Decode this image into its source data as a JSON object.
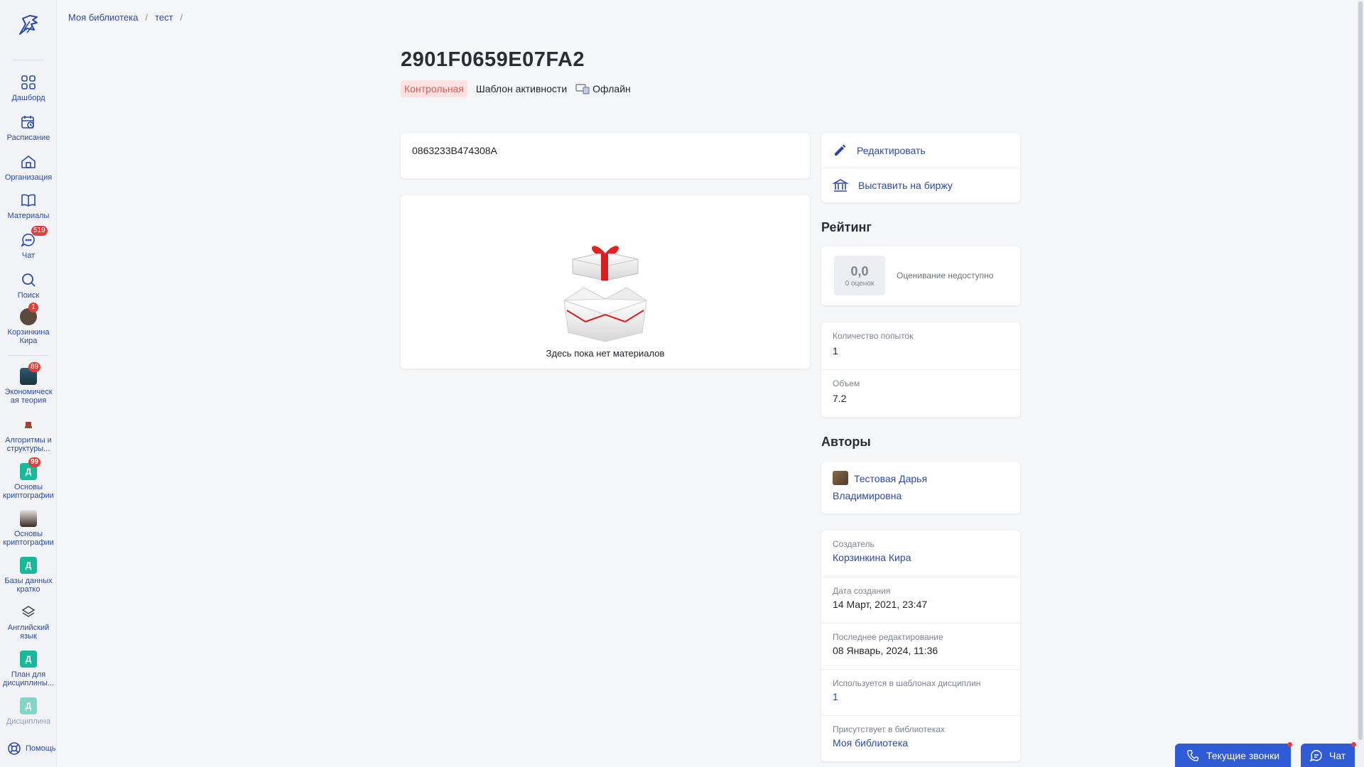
{
  "breadcrumb": {
    "items": [
      "Моя библиотека",
      "тест"
    ],
    "sep": "/"
  },
  "nav": {
    "dashboard": "Дашборд",
    "schedule": "Расписание",
    "organization": "Организация",
    "materials": "Материалы",
    "chat": "Чат",
    "chat_badge": "519",
    "search": "Поиск",
    "user_line1": "Корзинкина",
    "user_line2": "Кира",
    "user_badge": "1",
    "econ_line1": "Экономическ",
    "econ_line2": "ая теория",
    "econ_badge": "89",
    "algo_line1": "Алгоритмы и",
    "algo_line2": "структуры...",
    "crypto1_letter": "Д",
    "crypto1_line1": "Основы",
    "crypto1_line2": "криптографии",
    "crypto1_badge": "99",
    "crypto2_line1": "Основы",
    "crypto2_line2": "криптографии",
    "db_letter": "Д",
    "db_line1": "Базы данных",
    "db_line2": "кратко",
    "english_line1": "Английский",
    "english_line2": "язык",
    "plan_letter": "Д",
    "plan_line1": "План для",
    "plan_line2": "дисциплины...",
    "discipline_letter": "Д",
    "discipline": "Дисциплина",
    "help": "Помощь"
  },
  "header": {
    "title": "2901F0659E07FA2",
    "tag_type": "Контрольная",
    "tag_template": "Шаблон активности",
    "tag_mode": "Офлайн"
  },
  "content": {
    "code": "0863233B474308A",
    "empty_text": "Здесь пока нет материалов"
  },
  "actions": {
    "edit": "Редактировать",
    "exchange": "Выставить на биржу"
  },
  "rating": {
    "title": "Рейтинг",
    "value": "0,0",
    "count": "0 оценок",
    "status": "Оценивание недоступно"
  },
  "stats": {
    "attempts_label": "Количество попыток",
    "attempts_value": "1",
    "volume_label": "Объем",
    "volume_value": "7.2"
  },
  "authors": {
    "title": "Авторы",
    "name_line1": "Тестовая Дарья",
    "name_line2": "Владимировна"
  },
  "meta": {
    "creator_label": "Создатель",
    "creator_value": "Корзинкина Кира",
    "created_label": "Дата создания",
    "created_value": "14 Март, 2021, 23:47",
    "edited_label": "Последнее редактирование",
    "edited_value": "08 Январь, 2024, 11:36",
    "templates_label": "Используется в шаблонах дисциплин",
    "templates_value": "1",
    "libraries_label": "Присутствует в библиотеках",
    "libraries_value": "Моя библиотека"
  },
  "bottom": {
    "calls": "Текущие звонки",
    "chat": "Чат"
  },
  "colors": {
    "accent": "#2b4aa8",
    "button": "#2f5bd6",
    "badge": "#e33d3d",
    "tag_red_bg": "#fde2e1",
    "tag_red_text": "#e45a52",
    "letter_tile": "#18b89b"
  }
}
